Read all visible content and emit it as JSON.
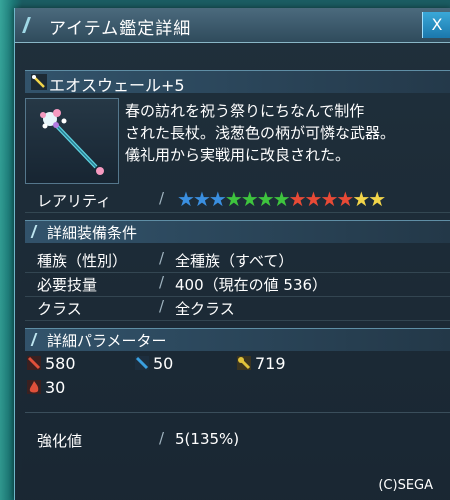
{
  "window": {
    "title": "アイテム鑑定詳細",
    "close_label": "X"
  },
  "item": {
    "icon": "sword-icon",
    "name": "エオスウェール+5",
    "description_lines": [
      "春の訪れを祝う祭りにちなんで制作",
      "された長杖。浅葱色の柄が可憐な武器。",
      "儀礼用から実戦用に改良された。"
    ]
  },
  "rarity": {
    "label": "レアリティ",
    "stars": 13,
    "star_colors": [
      "#3a8fe0",
      "#3a8fe0",
      "#3a8fe0",
      "#3ec43e",
      "#3ec43e",
      "#3ec43e",
      "#3ec43e",
      "#e84a36",
      "#e84a36",
      "#e84a36",
      "#e84a36",
      "#f2d54a",
      "#f2d54a"
    ]
  },
  "requirements": {
    "section_title": "詳細装備条件",
    "rows": [
      {
        "label": "種族（性別）",
        "value": "全種族（すべて）"
      },
      {
        "label": "必要技量",
        "value": "400（現在の値 536）"
      },
      {
        "label": "クラス",
        "value": "全クラス"
      }
    ]
  },
  "parameters": {
    "section_title": "詳細パラメーター",
    "items": [
      {
        "icon": "striking-attack-icon",
        "value": "580",
        "color": "#e0503a"
      },
      {
        "icon": "ranged-attack-icon",
        "value": "50",
        "color": "#3aa0e0"
      },
      {
        "icon": "technique-attack-icon",
        "value": "719",
        "color": "#e0c23a"
      },
      {
        "icon": "element-fire-icon",
        "value": "30",
        "color": "#e0503a"
      }
    ]
  },
  "grind": {
    "label": "強化値",
    "value": "5(135%)"
  },
  "footer": {
    "copyright": "(C)SEGA"
  }
}
